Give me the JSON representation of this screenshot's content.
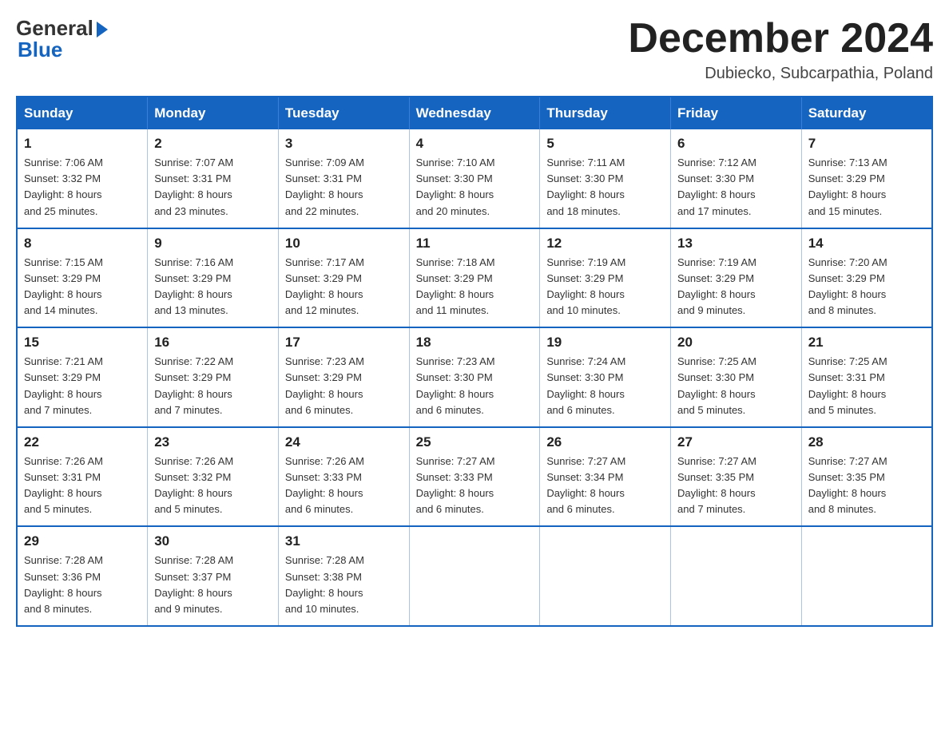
{
  "logo": {
    "general": "General",
    "blue": "Blue"
  },
  "header": {
    "title": "December 2024",
    "subtitle": "Dubiecko, Subcarpathia, Poland"
  },
  "days_of_week": [
    "Sunday",
    "Monday",
    "Tuesday",
    "Wednesday",
    "Thursday",
    "Friday",
    "Saturday"
  ],
  "weeks": [
    [
      {
        "day": "1",
        "sunrise": "7:06 AM",
        "sunset": "3:32 PM",
        "daylight": "8 hours and 25 minutes."
      },
      {
        "day": "2",
        "sunrise": "7:07 AM",
        "sunset": "3:31 PM",
        "daylight": "8 hours and 23 minutes."
      },
      {
        "day": "3",
        "sunrise": "7:09 AM",
        "sunset": "3:31 PM",
        "daylight": "8 hours and 22 minutes."
      },
      {
        "day": "4",
        "sunrise": "7:10 AM",
        "sunset": "3:30 PM",
        "daylight": "8 hours and 20 minutes."
      },
      {
        "day": "5",
        "sunrise": "7:11 AM",
        "sunset": "3:30 PM",
        "daylight": "8 hours and 18 minutes."
      },
      {
        "day": "6",
        "sunrise": "7:12 AM",
        "sunset": "3:30 PM",
        "daylight": "8 hours and 17 minutes."
      },
      {
        "day": "7",
        "sunrise": "7:13 AM",
        "sunset": "3:29 PM",
        "daylight": "8 hours and 15 minutes."
      }
    ],
    [
      {
        "day": "8",
        "sunrise": "7:15 AM",
        "sunset": "3:29 PM",
        "daylight": "8 hours and 14 minutes."
      },
      {
        "day": "9",
        "sunrise": "7:16 AM",
        "sunset": "3:29 PM",
        "daylight": "8 hours and 13 minutes."
      },
      {
        "day": "10",
        "sunrise": "7:17 AM",
        "sunset": "3:29 PM",
        "daylight": "8 hours and 12 minutes."
      },
      {
        "day": "11",
        "sunrise": "7:18 AM",
        "sunset": "3:29 PM",
        "daylight": "8 hours and 11 minutes."
      },
      {
        "day": "12",
        "sunrise": "7:19 AM",
        "sunset": "3:29 PM",
        "daylight": "8 hours and 10 minutes."
      },
      {
        "day": "13",
        "sunrise": "7:19 AM",
        "sunset": "3:29 PM",
        "daylight": "8 hours and 9 minutes."
      },
      {
        "day": "14",
        "sunrise": "7:20 AM",
        "sunset": "3:29 PM",
        "daylight": "8 hours and 8 minutes."
      }
    ],
    [
      {
        "day": "15",
        "sunrise": "7:21 AM",
        "sunset": "3:29 PM",
        "daylight": "8 hours and 7 minutes."
      },
      {
        "day": "16",
        "sunrise": "7:22 AM",
        "sunset": "3:29 PM",
        "daylight": "8 hours and 7 minutes."
      },
      {
        "day": "17",
        "sunrise": "7:23 AM",
        "sunset": "3:29 PM",
        "daylight": "8 hours and 6 minutes."
      },
      {
        "day": "18",
        "sunrise": "7:23 AM",
        "sunset": "3:30 PM",
        "daylight": "8 hours and 6 minutes."
      },
      {
        "day": "19",
        "sunrise": "7:24 AM",
        "sunset": "3:30 PM",
        "daylight": "8 hours and 6 minutes."
      },
      {
        "day": "20",
        "sunrise": "7:25 AM",
        "sunset": "3:30 PM",
        "daylight": "8 hours and 5 minutes."
      },
      {
        "day": "21",
        "sunrise": "7:25 AM",
        "sunset": "3:31 PM",
        "daylight": "8 hours and 5 minutes."
      }
    ],
    [
      {
        "day": "22",
        "sunrise": "7:26 AM",
        "sunset": "3:31 PM",
        "daylight": "8 hours and 5 minutes."
      },
      {
        "day": "23",
        "sunrise": "7:26 AM",
        "sunset": "3:32 PM",
        "daylight": "8 hours and 5 minutes."
      },
      {
        "day": "24",
        "sunrise": "7:26 AM",
        "sunset": "3:33 PM",
        "daylight": "8 hours and 6 minutes."
      },
      {
        "day": "25",
        "sunrise": "7:27 AM",
        "sunset": "3:33 PM",
        "daylight": "8 hours and 6 minutes."
      },
      {
        "day": "26",
        "sunrise": "7:27 AM",
        "sunset": "3:34 PM",
        "daylight": "8 hours and 6 minutes."
      },
      {
        "day": "27",
        "sunrise": "7:27 AM",
        "sunset": "3:35 PM",
        "daylight": "8 hours and 7 minutes."
      },
      {
        "day": "28",
        "sunrise": "7:27 AM",
        "sunset": "3:35 PM",
        "daylight": "8 hours and 8 minutes."
      }
    ],
    [
      {
        "day": "29",
        "sunrise": "7:28 AM",
        "sunset": "3:36 PM",
        "daylight": "8 hours and 8 minutes."
      },
      {
        "day": "30",
        "sunrise": "7:28 AM",
        "sunset": "3:37 PM",
        "daylight": "8 hours and 9 minutes."
      },
      {
        "day": "31",
        "sunrise": "7:28 AM",
        "sunset": "3:38 PM",
        "daylight": "8 hours and 10 minutes."
      },
      null,
      null,
      null,
      null
    ]
  ],
  "labels": {
    "sunrise": "Sunrise:",
    "sunset": "Sunset:",
    "daylight": "Daylight:"
  }
}
